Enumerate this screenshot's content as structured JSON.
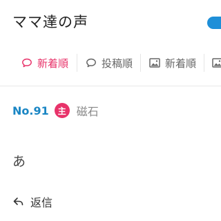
{
  "header": {
    "title": "ママ達の声"
  },
  "tabs": [
    {
      "label": "新着順",
      "icon": "speech-bubble-icon",
      "active": true
    },
    {
      "label": "投稿順",
      "icon": "speech-bubble-icon",
      "active": false
    },
    {
      "label": "新着順",
      "icon": "image-icon",
      "active": false
    },
    {
      "label": "",
      "icon": "image-icon",
      "active": false
    }
  ],
  "post": {
    "number": "No.91",
    "owner_badge": "主",
    "author": "磁石",
    "body": "あ",
    "reply_label": "返信"
  },
  "colors": {
    "accent_pink": "#e8336a",
    "accent_blue": "#1a86c4",
    "toggle_blue": "#1e8fd8"
  }
}
